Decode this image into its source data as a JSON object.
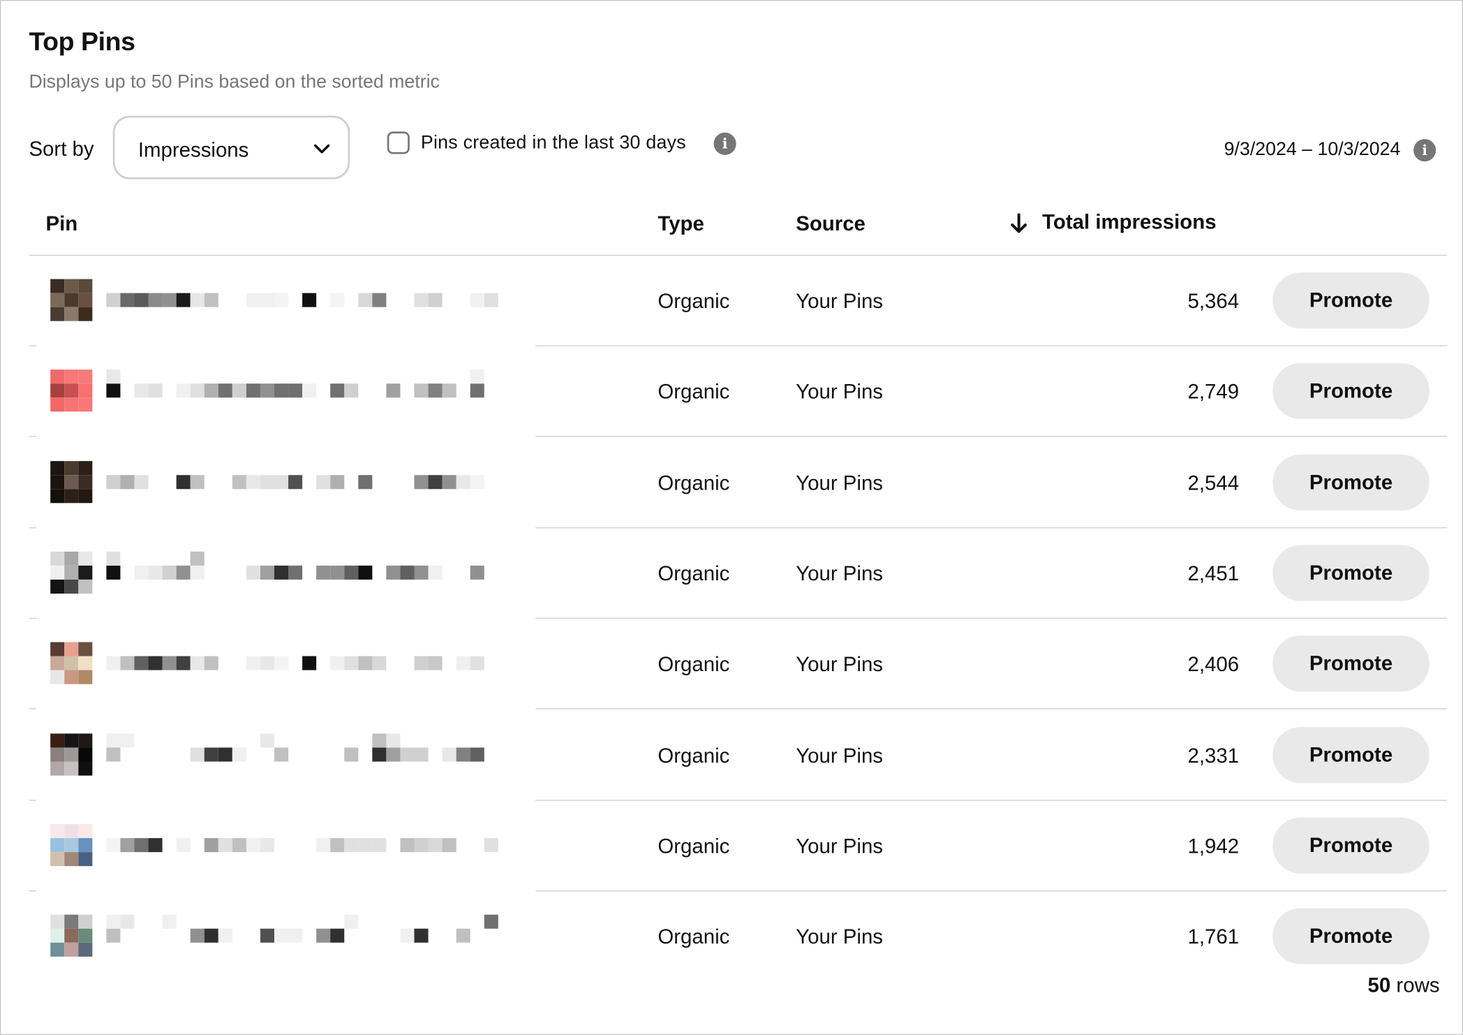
{
  "header": {
    "title": "Top Pins",
    "subtitle": "Displays up to 50 Pins based on the sorted metric"
  },
  "controls": {
    "sort_label": "Sort by",
    "sort_value": "Impressions",
    "checkbox_label": "Pins created in the last 30 days",
    "checkbox_checked": false,
    "date_range": "9/3/2024 – 10/3/2024"
  },
  "table": {
    "columns": {
      "pin": "Pin",
      "type": "Type",
      "source": "Source",
      "metric": "Total impressions"
    },
    "sort_direction": "descending",
    "rows": [
      {
        "type": "Organic",
        "source": "Your Pins",
        "impressions": "5,364",
        "action": "Promote"
      },
      {
        "type": "Organic",
        "source": "Your Pins",
        "impressions": "2,749",
        "action": "Promote"
      },
      {
        "type": "Organic",
        "source": "Your Pins",
        "impressions": "2,544",
        "action": "Promote"
      },
      {
        "type": "Organic",
        "source": "Your Pins",
        "impressions": "2,451",
        "action": "Promote"
      },
      {
        "type": "Organic",
        "source": "Your Pins",
        "impressions": "2,406",
        "action": "Promote"
      },
      {
        "type": "Organic",
        "source": "Your Pins",
        "impressions": "2,331",
        "action": "Promote"
      },
      {
        "type": "Organic",
        "source": "Your Pins",
        "impressions": "1,942",
        "action": "Promote"
      },
      {
        "type": "Organic",
        "source": "Your Pins",
        "impressions": "1,761",
        "action": "Promote"
      }
    ]
  },
  "footer": {
    "rows_count": "50",
    "rows_suffix": "rows"
  },
  "thumbnails": [
    [
      "#3a2c22",
      "#6b5a4a",
      "#5a4a3c",
      "#7a6a5a",
      "#4a3a2c",
      "#6a5040",
      "#4a3c34",
      "#8a7a6a",
      "#3c2c20"
    ],
    [
      "#f06a6a",
      "#f77878",
      "#f87a7a",
      "#a84040",
      "#c85050",
      "#f87070",
      "#f26868",
      "#f67474",
      "#f87878"
    ],
    [
      "#1c1410",
      "#4a3a30",
      "#2a2018",
      "#1a1410",
      "#6a5a50",
      "#3a2c24",
      "#14100c",
      "#2c2018",
      "#221810"
    ],
    [
      "#d8d8d8",
      "#a8a8a8",
      "#e8e8e8",
      "#f0f0f0",
      "#b0b0b0",
      "#1a1a1a",
      "#141414",
      "#484848",
      "#c0c0c0"
    ],
    [
      "#5a3a32",
      "#e8a090",
      "#6a5040",
      "#c8a898",
      "#d0c0a8",
      "#f0e0c8",
      "#e8e8e8",
      "#c89880",
      "#b08868"
    ],
    [
      "#3a1e14",
      "#141414",
      "#201818",
      "#8a8080",
      "#a09898",
      "#080808",
      "#b0a8a8",
      "#c8c0c0",
      "#101010"
    ],
    [
      "#f8e8ec",
      "#f0e0e4",
      "#f8e8ea",
      "#98c0e0",
      "#a8c8e0",
      "#6890c0",
      "#d0c0b0",
      "#a08878",
      "#4a6080"
    ],
    [
      "#e0e0e0",
      "#7a7a7a",
      "#d0d0d0",
      "#e0f0e8",
      "#8a6a5a",
      "#6a8a7a",
      "#709098",
      "#c0a0a0",
      "#5a6a7a"
    ]
  ]
}
